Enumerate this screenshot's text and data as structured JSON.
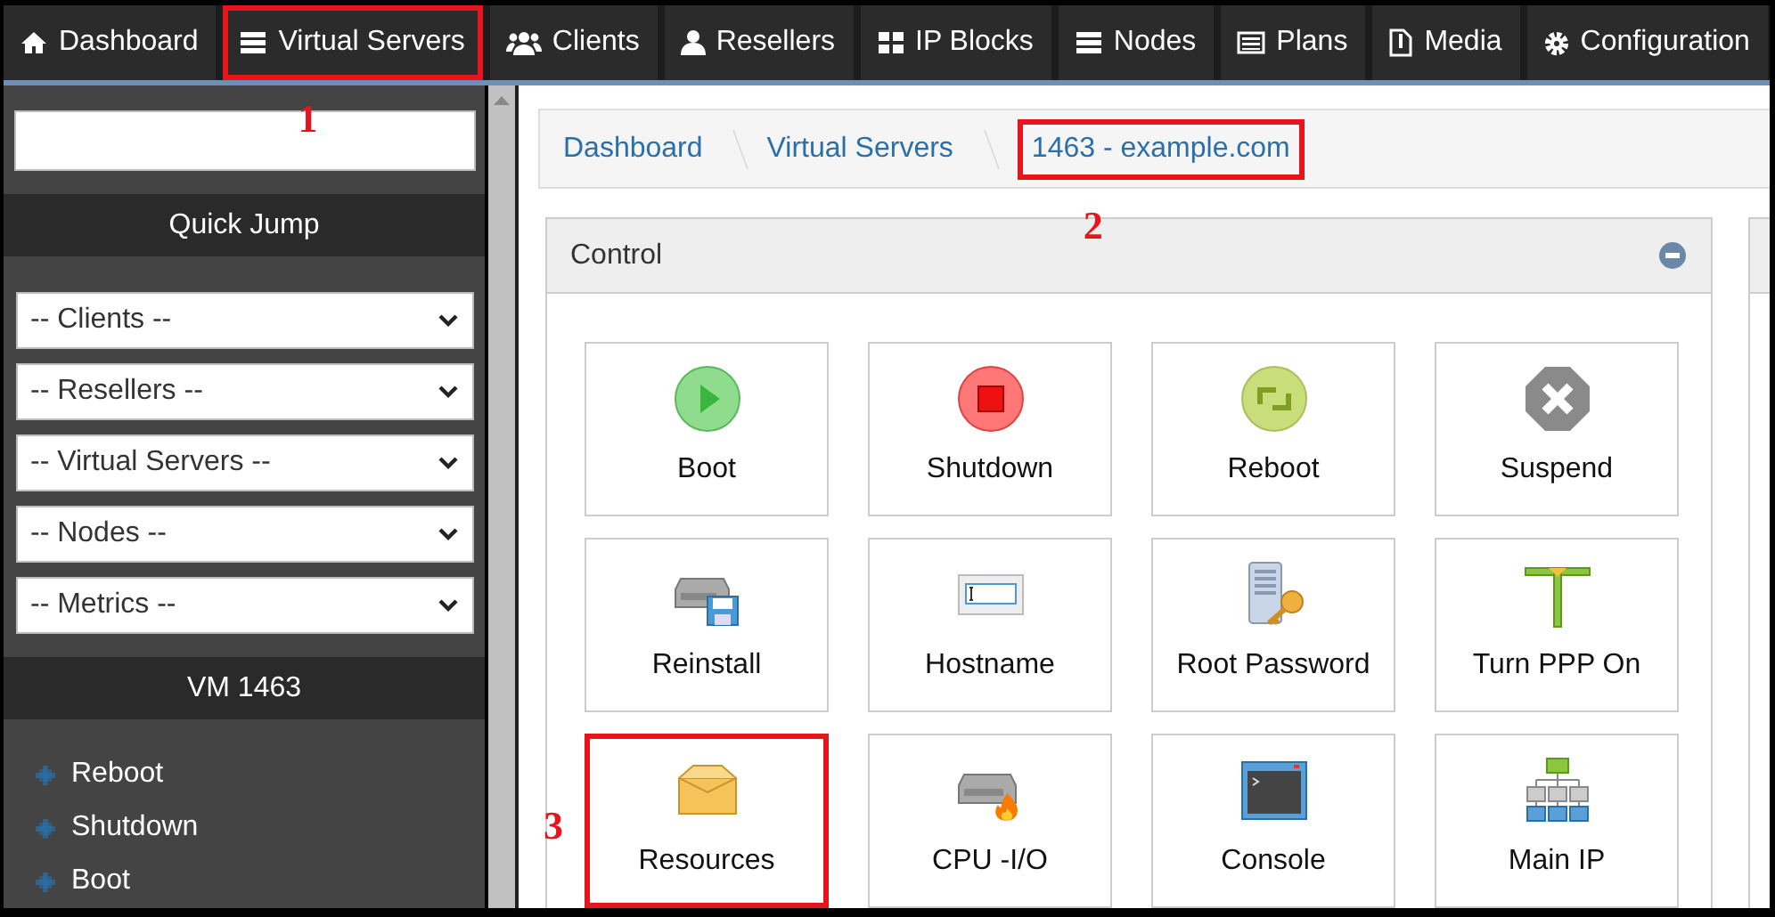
{
  "nav": [
    {
      "label": "Dashboard",
      "highlighted": false
    },
    {
      "label": "Virtual Servers",
      "highlighted": true,
      "callout": "1"
    },
    {
      "label": "Clients",
      "highlighted": false
    },
    {
      "label": "Resellers",
      "highlighted": false
    },
    {
      "label": "IP Blocks",
      "highlighted": false
    },
    {
      "label": "Nodes",
      "highlighted": false
    },
    {
      "label": "Plans",
      "highlighted": false
    },
    {
      "label": "Media",
      "highlighted": false
    },
    {
      "label": "Configuration",
      "highlighted": false
    }
  ],
  "sidebar": {
    "quick_jump_title": "Quick Jump",
    "selects": [
      "-- Clients --",
      "-- Resellers --",
      "-- Virtual Servers --",
      "-- Nodes --",
      "-- Metrics --"
    ],
    "vm_title": "VM 1463",
    "actions": [
      "Reboot",
      "Shutdown",
      "Boot"
    ]
  },
  "breadcrumb": [
    {
      "label": "Dashboard",
      "highlighted": false
    },
    {
      "label": "Virtual Servers",
      "highlighted": false
    },
    {
      "label": "1463 - example.com",
      "highlighted": true,
      "callout": "2"
    }
  ],
  "panel": {
    "title": "Control",
    "tiles": [
      {
        "label": "Boot",
        "highlighted": false
      },
      {
        "label": "Shutdown",
        "highlighted": false
      },
      {
        "label": "Reboot",
        "highlighted": false
      },
      {
        "label": "Suspend",
        "highlighted": false
      },
      {
        "label": "Reinstall",
        "highlighted": false
      },
      {
        "label": "Hostname",
        "highlighted": false
      },
      {
        "label": "Root Password",
        "highlighted": false
      },
      {
        "label": "Turn PPP On",
        "highlighted": false
      },
      {
        "label": "Resources",
        "highlighted": true,
        "callout": "3"
      },
      {
        "label": "CPU -I/O",
        "highlighted": false
      },
      {
        "label": "Console",
        "highlighted": false
      },
      {
        "label": "Main IP",
        "highlighted": false
      }
    ]
  }
}
